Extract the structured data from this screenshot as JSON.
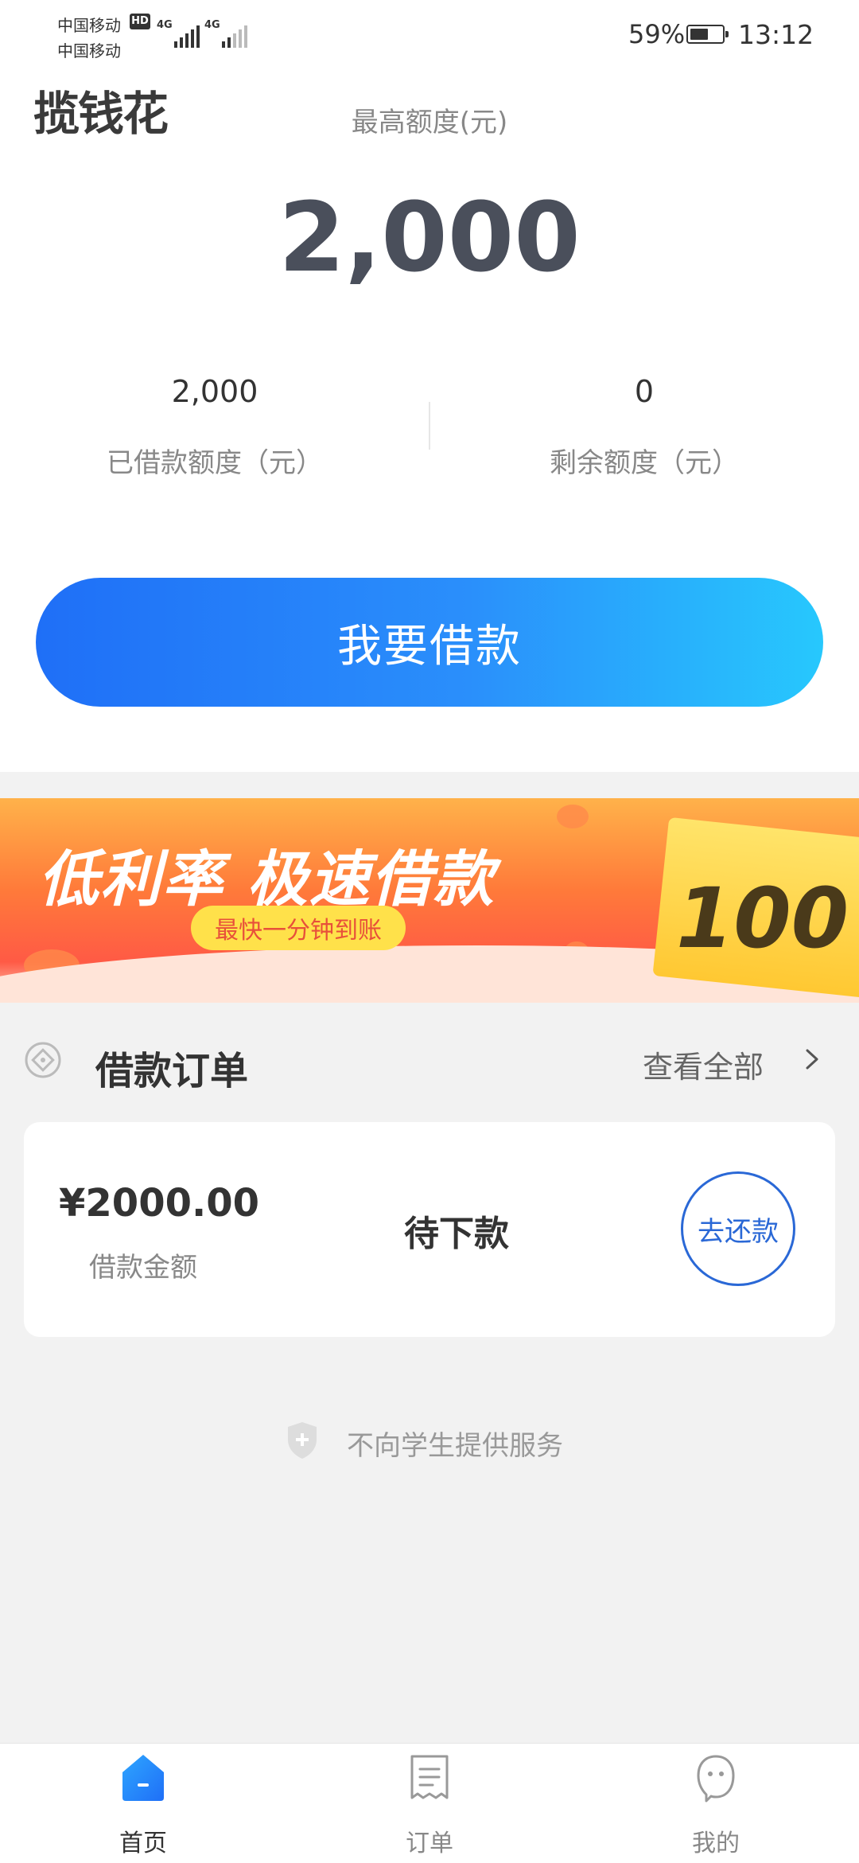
{
  "status_bar": {
    "carrier_1": "中国移动",
    "carrier_2": "中国移动",
    "hd_badge": "HD",
    "signal_1_type": "4G",
    "signal_2_type": "4G",
    "battery_percent": "59%",
    "battery_level": 0.59,
    "time": "13:12"
  },
  "header": {
    "app_logo": "揽钱花"
  },
  "credit": {
    "max_label": "最高额度(元)",
    "max_amount": "2,000",
    "borrowed_value": "2,000",
    "borrowed_label": "已借款额度（元）",
    "remaining_value": "0",
    "remaining_label": "剩余额度（元）"
  },
  "actions": {
    "borrow_label": "我要借款"
  },
  "banner": {
    "slogan": "低利率 极速借款",
    "sub": "最快一分钟到账",
    "ticket_number": "100"
  },
  "orders": {
    "title": "借款订单",
    "view_all": "查看全部",
    "card": {
      "amount": "¥2000.00",
      "amount_label": "借款金额",
      "status": "待下款",
      "repay_label": "去还款"
    }
  },
  "notice": {
    "text": "不向学生提供服务"
  },
  "tabbar": {
    "items": [
      {
        "label": "首页",
        "icon": "home-icon",
        "active": true
      },
      {
        "label": "订单",
        "icon": "order-receipt-icon",
        "active": false
      },
      {
        "label": "我的",
        "icon": "profile-icon",
        "active": false
      }
    ]
  },
  "colors": {
    "accent": "#2a68d6",
    "button_gradient_start": "#1f6ff7",
    "button_gradient_end": "#27c8fd",
    "background": "#f2f2f2"
  }
}
